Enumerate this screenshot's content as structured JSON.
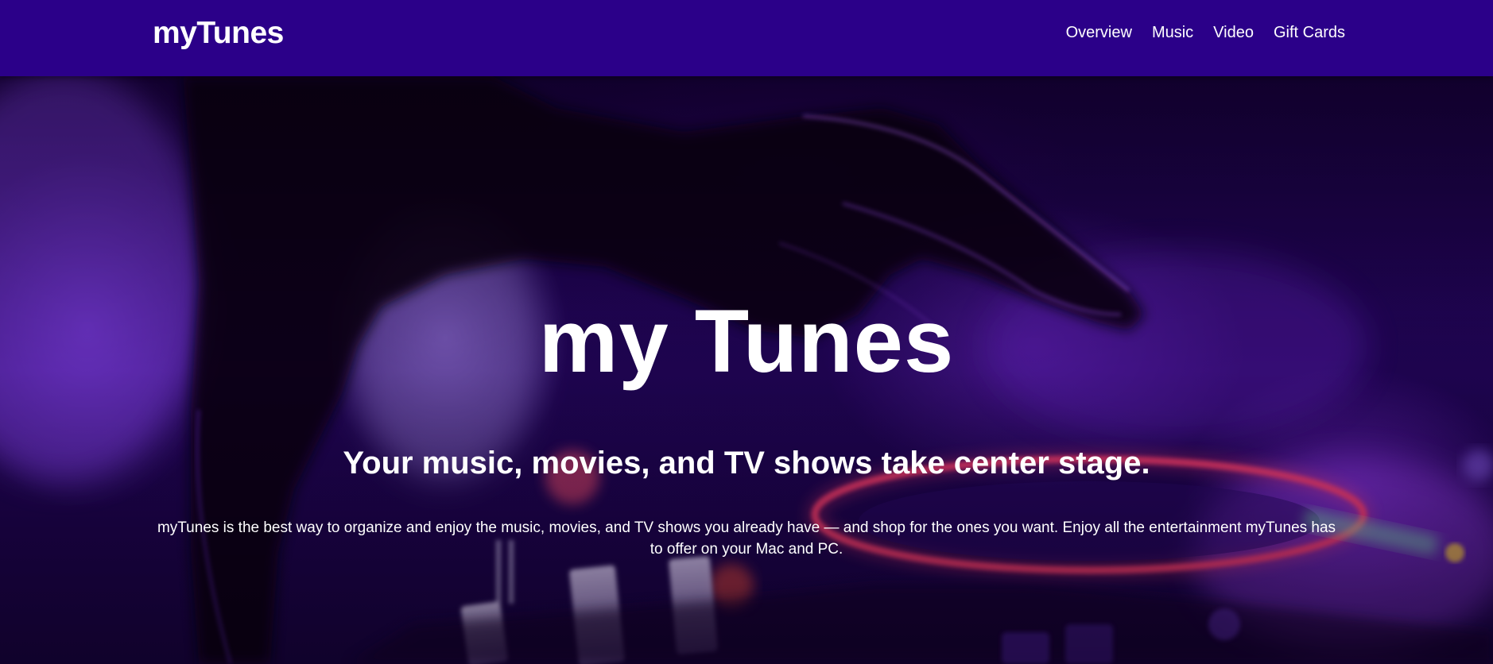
{
  "header": {
    "brand": "myTunes",
    "nav": [
      {
        "label": "Overview"
      },
      {
        "label": "Music"
      },
      {
        "label": "Video"
      },
      {
        "label": "Gift Cards"
      }
    ]
  },
  "hero": {
    "title": "my Tunes",
    "subtitle": "Your music, movies, and TV shows take center stage.",
    "description": "myTunes is the best way to organize and enjoy the music, movies, and TV shows you already have — and shop for the ones you want. Enjoy all the entertainment myTunes has to offer on your Mac and PC."
  },
  "colors": {
    "header_bg": "#2b0089",
    "text": "#ffffff",
    "accent_red": "#ff3060",
    "accent_purple": "#7a2ce0"
  }
}
